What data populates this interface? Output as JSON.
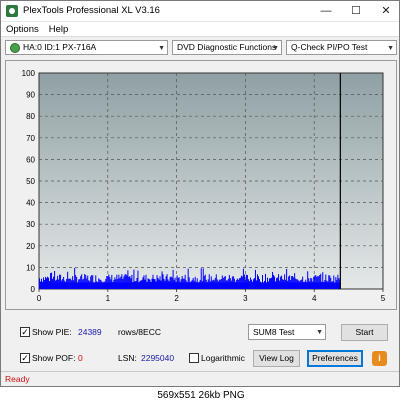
{
  "window": {
    "title": "PlexTools Professional XL V3.16",
    "minimize_glyph": "—",
    "maximize_glyph": "☐",
    "close_glyph": "✕"
  },
  "menu": {
    "options_label": "Options",
    "help_label": "Help"
  },
  "toolbar": {
    "drive": "HA:0 ID:1  PX-716A",
    "function": "DVD Diagnostic Functions",
    "test": "Q-Check PI/PO Test",
    "arrow_glyph": "▼"
  },
  "chart_data": {
    "type": "bar",
    "title": "",
    "xlabel": "",
    "ylabel": "",
    "xlim": [
      0,
      5
    ],
    "ylim": [
      0,
      100
    ],
    "x_ticks": [
      "0",
      "1",
      "2",
      "3",
      "4",
      "5"
    ],
    "y_ticks": [
      "100",
      "90",
      "80",
      "70",
      "60",
      "50",
      "40",
      "30",
      "20",
      "10",
      "0"
    ],
    "grid": true,
    "scan_end_x": 4.38,
    "series": [
      {
        "values_baseline": 3,
        "values_typical_max": 7,
        "values_peak": 10,
        "color": "#0000ff"
      }
    ],
    "background_top": "#8fa0a4",
    "background_bottom": "#e4e8e8"
  },
  "controls": {
    "show_pie_label": "Show PIE:",
    "pie_value": "24389",
    "pie_unit": "rows/8ECC",
    "show_pof_label": "Show POF:",
    "pof_value": "0",
    "lsn_label": "LSN:",
    "lsn_value": "2295040",
    "logarithmic_label": "Logarithmic",
    "sum_select": "SUM8 Test",
    "start_button": "Start",
    "view_log_button": "View Log",
    "preferences_button": "Preferences",
    "info_button": "i",
    "check_glyph": "✓"
  },
  "status": {
    "text": "Ready"
  },
  "caption": "569x551  26kb  PNG",
  "colors": {
    "status_red": "#d01010",
    "value_blue": "#1a1aa8",
    "series_blue": "#0000ff"
  }
}
